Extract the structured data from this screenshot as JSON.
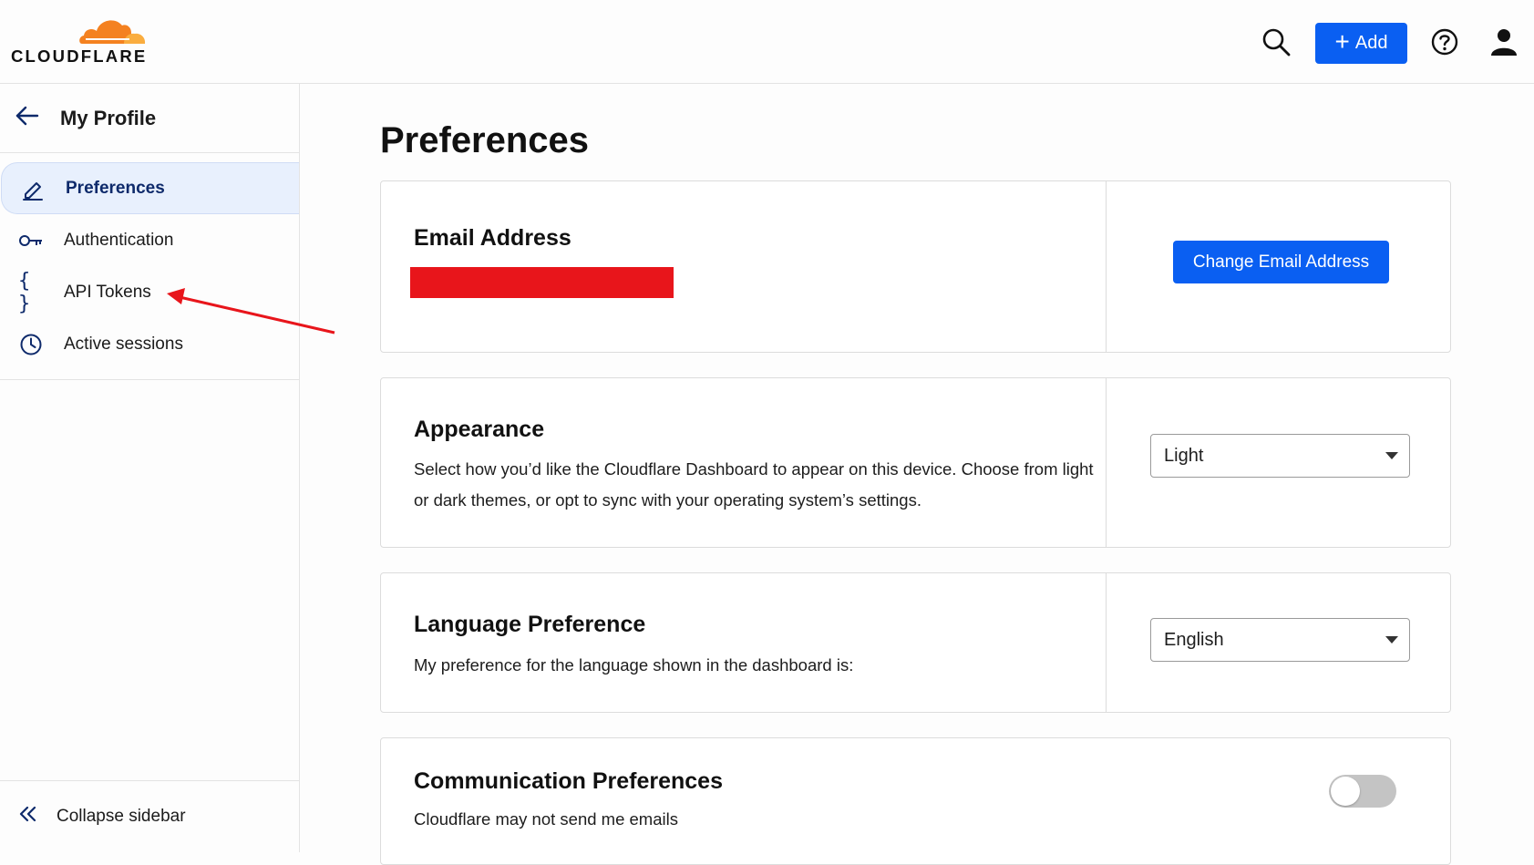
{
  "header": {
    "logo_text": "CLOUDFLARE",
    "add_label": "Add",
    "icons": [
      "search-icon",
      "help-icon",
      "user-icon"
    ]
  },
  "sidebar": {
    "title": "My Profile",
    "items": [
      {
        "label": "Preferences",
        "icon": "pencil-icon",
        "active": true
      },
      {
        "label": "Authentication",
        "icon": "key-icon",
        "active": false
      },
      {
        "label": "API Tokens",
        "icon": "braces-icon",
        "active": false
      },
      {
        "label": "Active sessions",
        "icon": "clock-icon",
        "active": false
      }
    ],
    "collapse_label": "Collapse sidebar"
  },
  "main": {
    "title": "Preferences",
    "email": {
      "heading": "Email Address",
      "button_label": "Change Email Address"
    },
    "appearance": {
      "heading": "Appearance",
      "description": "Select how you’d like the Cloudflare Dashboard to appear on this device. Choose from light or dark themes, or opt to sync with your operating system’s settings.",
      "selected": "Light"
    },
    "language": {
      "heading": "Language Preference",
      "description": "My preference for the language shown in the dashboard is:",
      "selected": "English"
    },
    "communication": {
      "heading": "Communication Preferences",
      "description": "Cloudflare may not send me emails",
      "toggle_on": false
    }
  },
  "colors": {
    "accent": "#0a5ff2",
    "logo_orange": "#f48120",
    "logo_light_orange": "#faad3f",
    "active_bg": "#e8f0fd",
    "annotation_red": "#e8151b"
  }
}
